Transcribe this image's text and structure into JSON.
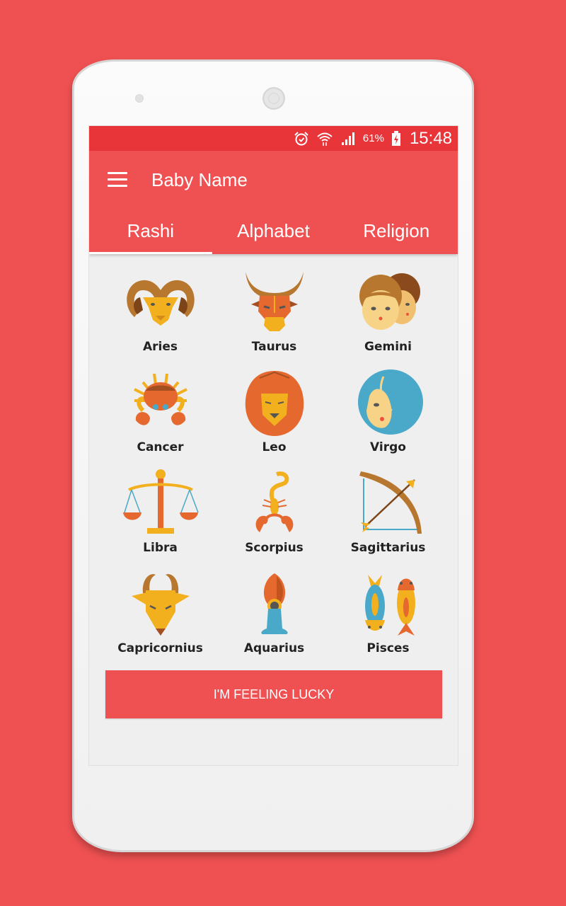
{
  "status_bar": {
    "icons": [
      "alarm-icon",
      "wifi-icon",
      "signal-icon",
      "battery-charging-icon"
    ],
    "battery": "61%",
    "time": "15:48"
  },
  "toolbar": {
    "menu_icon": "hamburger-menu-icon",
    "title": "Baby Name"
  },
  "tabs": [
    {
      "label": "Rashi",
      "active": true
    },
    {
      "label": "Alphabet",
      "active": false
    },
    {
      "label": "Religion",
      "active": false
    }
  ],
  "signs": [
    {
      "name": "Aries",
      "icon": "ram-icon"
    },
    {
      "name": "Taurus",
      "icon": "bull-icon"
    },
    {
      "name": "Gemini",
      "icon": "twins-icon"
    },
    {
      "name": "Cancer",
      "icon": "crab-icon"
    },
    {
      "name": "Leo",
      "icon": "lion-icon"
    },
    {
      "name": "Virgo",
      "icon": "maiden-icon"
    },
    {
      "name": "Libra",
      "icon": "scales-icon"
    },
    {
      "name": "Scorpius",
      "icon": "scorpion-icon"
    },
    {
      "name": "Sagittarius",
      "icon": "bow-arrow-icon"
    },
    {
      "name": "Capricornius",
      "icon": "goat-icon"
    },
    {
      "name": "Aquarius",
      "icon": "water-jar-icon"
    },
    {
      "name": "Pisces",
      "icon": "fish-icon"
    }
  ],
  "lucky_button": "I'M FEELING LUCKY",
  "colors": {
    "primary": "#ef5152",
    "status_bar": "#e8353a",
    "background": "#efefef"
  }
}
